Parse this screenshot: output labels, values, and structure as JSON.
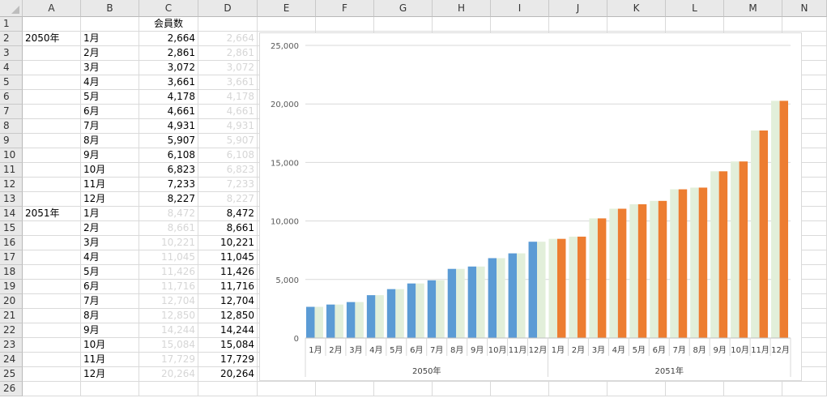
{
  "columns": [
    "A",
    "B",
    "C",
    "D",
    "E",
    "F",
    "G",
    "H",
    "I",
    "J",
    "K",
    "L",
    "M",
    "N"
  ],
  "rows": [
    {
      "n": "1",
      "a": "",
      "b": "",
      "c": "会員数",
      "d": ""
    },
    {
      "n": "2",
      "a": "2050年",
      "b": "1月",
      "c": "2,664",
      "d": "2,664"
    },
    {
      "n": "3",
      "a": "",
      "b": "2月",
      "c": "2,861",
      "d": "2,861"
    },
    {
      "n": "4",
      "a": "",
      "b": "3月",
      "c": "3,072",
      "d": "3,072"
    },
    {
      "n": "5",
      "a": "",
      "b": "4月",
      "c": "3,661",
      "d": "3,661"
    },
    {
      "n": "6",
      "a": "",
      "b": "5月",
      "c": "4,178",
      "d": "4,178"
    },
    {
      "n": "7",
      "a": "",
      "b": "6月",
      "c": "4,661",
      "d": "4,661"
    },
    {
      "n": "8",
      "a": "",
      "b": "7月",
      "c": "4,931",
      "d": "4,931"
    },
    {
      "n": "9",
      "a": "",
      "b": "8月",
      "c": "5,907",
      "d": "5,907"
    },
    {
      "n": "10",
      "a": "",
      "b": "9月",
      "c": "6,108",
      "d": "6,108"
    },
    {
      "n": "11",
      "a": "",
      "b": "10月",
      "c": "6,823",
      "d": "6,823"
    },
    {
      "n": "12",
      "a": "",
      "b": "11月",
      "c": "7,233",
      "d": "7,233"
    },
    {
      "n": "13",
      "a": "",
      "b": "12月",
      "c": "8,227",
      "d": "8,227"
    },
    {
      "n": "14",
      "a": "2051年",
      "b": "1月",
      "c": "8,472",
      "d": "8,472"
    },
    {
      "n": "15",
      "a": "",
      "b": "2月",
      "c": "8,661",
      "d": "8,661"
    },
    {
      "n": "16",
      "a": "",
      "b": "3月",
      "c": "10,221",
      "d": "10,221"
    },
    {
      "n": "17",
      "a": "",
      "b": "4月",
      "c": "11,045",
      "d": "11,045"
    },
    {
      "n": "18",
      "a": "",
      "b": "5月",
      "c": "11,426",
      "d": "11,426"
    },
    {
      "n": "19",
      "a": "",
      "b": "6月",
      "c": "11,716",
      "d": "11,716"
    },
    {
      "n": "20",
      "a": "",
      "b": "7月",
      "c": "12,704",
      "d": "12,704"
    },
    {
      "n": "21",
      "a": "",
      "b": "8月",
      "c": "12,850",
      "d": "12,850"
    },
    {
      "n": "22",
      "a": "",
      "b": "9月",
      "c": "14,244",
      "d": "14,244"
    },
    {
      "n": "23",
      "a": "",
      "b": "10月",
      "c": "15,084",
      "d": "15,084"
    },
    {
      "n": "24",
      "a": "",
      "b": "11月",
      "c": "17,729",
      "d": "17,729"
    },
    {
      "n": "25",
      "a": "",
      "b": "12月",
      "c": "20,264",
      "d": "20,264"
    },
    {
      "n": "26",
      "a": "",
      "b": "",
      "c": "",
      "d": ""
    }
  ],
  "ghost_c_rows": [
    "14",
    "15",
    "16",
    "17",
    "18",
    "19",
    "20",
    "21",
    "22",
    "23",
    "24",
    "25"
  ],
  "ghost_d_rows": [
    "2",
    "3",
    "4",
    "5",
    "6",
    "7",
    "8",
    "9",
    "10",
    "11",
    "12",
    "13"
  ],
  "chart_data": {
    "type": "bar",
    "ylim": [
      0,
      25000
    ],
    "yticks": [
      "0",
      "5,000",
      "10,000",
      "15,000",
      "20,000",
      "25,000"
    ],
    "ytick_values": [
      0,
      5000,
      10000,
      15000,
      20000,
      25000
    ],
    "groups": [
      {
        "label": "2050年",
        "months": [
          "1月",
          "2月",
          "3月",
          "4月",
          "5月",
          "6月",
          "7月",
          "8月",
          "9月",
          "10月",
          "11月",
          "12月"
        ]
      },
      {
        "label": "2051年",
        "months": [
          "1月",
          "2月",
          "3月",
          "4月",
          "5月",
          "6月",
          "7月",
          "8月",
          "9月",
          "10月",
          "11月",
          "12月"
        ]
      }
    ],
    "series": [
      {
        "color": "#5b9bd5",
        "values": [
          2664,
          2861,
          3072,
          3661,
          4178,
          4661,
          4931,
          5907,
          6108,
          6823,
          7233,
          8227,
          null,
          null,
          null,
          null,
          null,
          null,
          null,
          null,
          null,
          null,
          null,
          null
        ]
      },
      {
        "color": "#e2efda",
        "values": [
          2664,
          2861,
          3072,
          3661,
          4178,
          4661,
          4931,
          5907,
          6108,
          6823,
          7233,
          8227,
          8472,
          8661,
          10221,
          11045,
          11426,
          11716,
          12704,
          12850,
          14244,
          15084,
          17729,
          20264
        ]
      },
      {
        "color": "#ed7d31",
        "values": [
          null,
          null,
          null,
          null,
          null,
          null,
          null,
          null,
          null,
          null,
          null,
          null,
          8472,
          8661,
          10221,
          11045,
          11426,
          11716,
          12704,
          12850,
          14244,
          15084,
          17729,
          20264
        ]
      }
    ],
    "grid": true,
    "legend": "none"
  }
}
